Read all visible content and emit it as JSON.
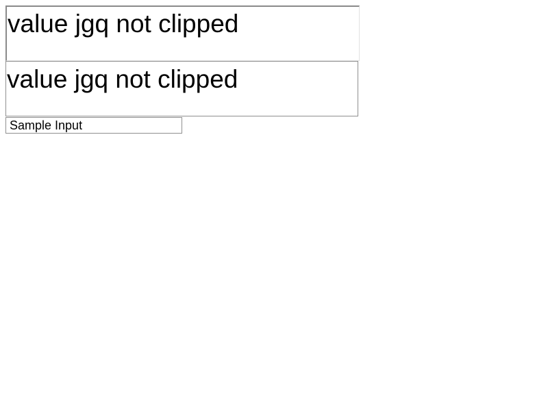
{
  "inputs": {
    "first_value": "value jgq not clipped",
    "second_value": "value jgq not clipped",
    "third_value": "Sample Input"
  }
}
